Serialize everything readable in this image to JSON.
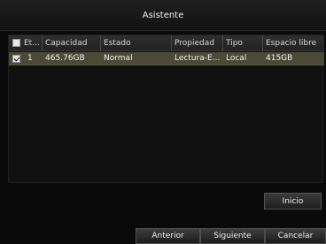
{
  "window": {
    "title": "Asistente"
  },
  "table": {
    "headers": [
      "Et...",
      "Capacidad",
      "Estado",
      "Propiedad",
      "Tipo",
      "Espacio libre"
    ],
    "rows": [
      {
        "checked": true,
        "label": "1",
        "capacidad": "465.76GB",
        "estado": "Normal",
        "propiedad": "Lectura-E...",
        "tipo": "Local",
        "espacio_libre": "415GB"
      }
    ]
  },
  "buttons": {
    "inicio": "Inicio",
    "anterior": "Anterior",
    "siguiente": "Siguiente",
    "cancelar": "Cancelar"
  }
}
